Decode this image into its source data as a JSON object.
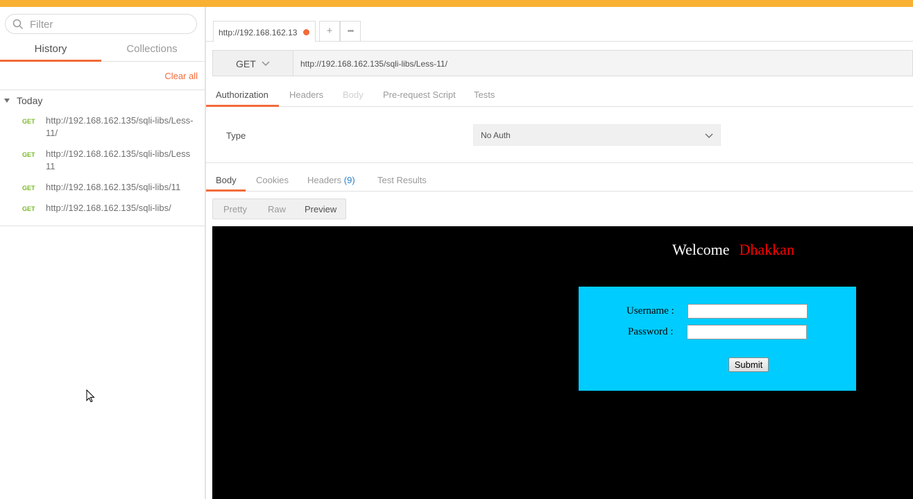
{
  "sidebar": {
    "filter_placeholder": "Filter",
    "tabs": [
      {
        "label": "History",
        "active": true
      },
      {
        "label": "Collections",
        "active": false
      }
    ],
    "clear_all": "Clear all",
    "group_label": "Today",
    "history": [
      {
        "method": "GET",
        "url": "http://192.168.162.135/sqli-libs/Less-11/"
      },
      {
        "method": "GET",
        "url": "http://192.168.162.135/sqli-libs/Less11"
      },
      {
        "method": "GET",
        "url": "http://192.168.162.135/sqli-libs/11"
      },
      {
        "method": "GET",
        "url": "http://192.168.162.135/sqli-libs/"
      }
    ]
  },
  "request": {
    "tab_label": "http://192.168.162.13",
    "new_tab": "+",
    "more": "•••",
    "method": "GET",
    "url": "http://192.168.162.135/sqli-libs/Less-11/",
    "subtabs": [
      {
        "label": "Authorization",
        "state": "active"
      },
      {
        "label": "Headers",
        "state": "normal"
      },
      {
        "label": "Body",
        "state": "disabled"
      },
      {
        "label": "Pre-request Script",
        "state": "normal"
      },
      {
        "label": "Tests",
        "state": "normal"
      }
    ],
    "auth_type_label": "Type",
    "auth_type_value": "No Auth"
  },
  "response": {
    "tabs": [
      {
        "label": "Body"
      },
      {
        "label": "Cookies"
      },
      {
        "label": "Headers",
        "count": "(9)"
      },
      {
        "label": "Test Results"
      }
    ],
    "view_modes": [
      {
        "label": "Pretty",
        "active": false
      },
      {
        "label": "Raw",
        "active": false
      },
      {
        "label": "Preview",
        "active": true
      }
    ],
    "preview": {
      "welcome": "Welcome",
      "name": "Dhakkan",
      "username_label": "Username :",
      "password_label": "Password :",
      "submit_label": "Submit"
    }
  },
  "colors": {
    "accent": "#f26b3a",
    "get_method": "#7ab928",
    "top_banner": "#f8b133",
    "preview_bg": "#000000",
    "login_box": "#00ccff",
    "name_red": "#ff0000"
  }
}
